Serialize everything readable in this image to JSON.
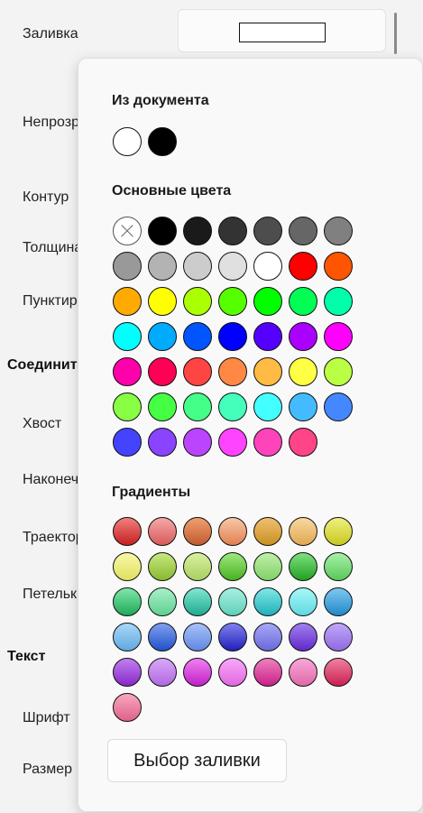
{
  "properties": {
    "fill_label": "Заливка",
    "opacity_label": "Непрозрачность",
    "outline_label": "Контур",
    "thickness_label": "Толщина",
    "dash_label": "Пунктир",
    "connector_section": "Соединитель",
    "tail_label": "Хвост",
    "head_label": "Наконечник",
    "path_label": "Траектория",
    "loop_label": "Петелька",
    "text_section": "Текст",
    "font_label": "Шрифт",
    "size_label": "Размер"
  },
  "fill_value_color": "#ffffff",
  "picker": {
    "from_document_heading": "Из документа",
    "basic_colors_heading": "Основные цвета",
    "gradients_heading": "Градиенты",
    "choose_fill_button": "Выбор заливки",
    "document_colors": [
      "#ffffff",
      "#000000"
    ],
    "basic_colors": [
      "none",
      "#000000",
      "#1a1a1a",
      "#333333",
      "#4d4d4d",
      "#666666",
      "#808080",
      "#999999",
      "#b3b3b3",
      "#cccccc",
      "#e0e0e0",
      "#ffffff",
      "#ff0000",
      "#ff5500",
      "#ffaa00",
      "#ffff00",
      "#aaff00",
      "#55ff00",
      "#00ff00",
      "#00ff55",
      "#00ffaa",
      "#00ffff",
      "#00aaff",
      "#0055ff",
      "#0000ff",
      "#5500ff",
      "#aa00ff",
      "#ff00ff",
      "#ff00aa",
      "#ff0055",
      "#ff4444",
      "#ff8844",
      "#ffbb44",
      "#ffff44",
      "#bbff44",
      "#88ff44",
      "#44ff44",
      "#44ff88",
      "#44ffbb",
      "#44ffff",
      "#44bbff",
      "#4488ff",
      "#4444ff",
      "#8844ff",
      "#bb44ff",
      "#ff44ff",
      "#ff44bb",
      "#ff4488"
    ],
    "gradients": [
      [
        "#f08080",
        "#c81e1e"
      ],
      [
        "#f5a8a8",
        "#d85a5a"
      ],
      [
        "#f0a070",
        "#c05a30"
      ],
      [
        "#f8c8a8",
        "#e08050"
      ],
      [
        "#f0c070",
        "#c89020"
      ],
      [
        "#f8d8a0",
        "#e0a850"
      ],
      [
        "#f0f080",
        "#c8c820"
      ],
      [
        "#f8f8a8",
        "#e0e060"
      ],
      [
        "#c8e880",
        "#88b830"
      ],
      [
        "#d8f0a0",
        "#a8d060"
      ],
      [
        "#a0e880",
        "#48b020"
      ],
      [
        "#c0f0a8",
        "#80d068"
      ],
      [
        "#80e080",
        "#20a020"
      ],
      [
        "#a8f0a8",
        "#58c858"
      ],
      [
        "#80e8a8",
        "#20a858"
      ],
      [
        "#a8f0c8",
        "#60d090"
      ],
      [
        "#80e8d0",
        "#20a890"
      ],
      [
        "#a8f0e0",
        "#60d0b8"
      ],
      [
        "#80e8e8",
        "#20b0b8"
      ],
      [
        "#a8f8f8",
        "#60d8e0"
      ],
      [
        "#80c8f0",
        "#2088c8"
      ],
      [
        "#a8d8f8",
        "#60a8e0"
      ],
      [
        "#80a0f0",
        "#2050c8"
      ],
      [
        "#a8c0f8",
        "#6088e0"
      ],
      [
        "#8080f0",
        "#2020b8"
      ],
      [
        "#a8a8f8",
        "#6868d8"
      ],
      [
        "#a080f0",
        "#6028c8"
      ],
      [
        "#c0a8f8",
        "#9068e0"
      ],
      [
        "#c080f0",
        "#8828c8"
      ],
      [
        "#d8a8f8",
        "#b068e0"
      ],
      [
        "#f080f0",
        "#c020c8"
      ],
      [
        "#f8a8f8",
        "#e068e0"
      ],
      [
        "#f080c0",
        "#c82088"
      ],
      [
        "#f8a8d8",
        "#e068a8"
      ],
      [
        "#f080a0",
        "#c82050"
      ],
      [
        "#f8a8c0",
        "#e06088"
      ]
    ]
  }
}
